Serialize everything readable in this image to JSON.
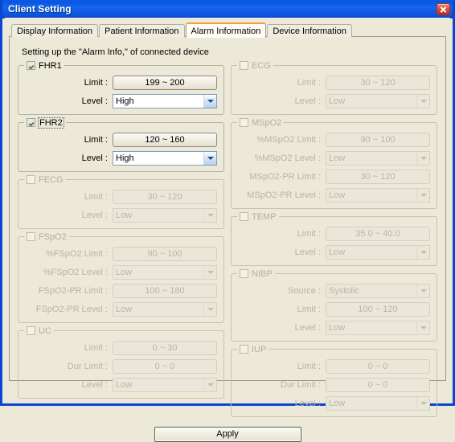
{
  "window": {
    "title": "Client Setting",
    "close_icon": "close-icon"
  },
  "tabs": [
    {
      "label": "Display Information",
      "active": false
    },
    {
      "label": "Patient Information",
      "active": false
    },
    {
      "label": "Alarm Information",
      "active": true
    },
    {
      "label": "Device Information",
      "active": false
    }
  ],
  "intro": "Setting up the \"Alarm Info,\" of connected device",
  "labels": {
    "limit": "Limit :",
    "level": "Level :",
    "dur_limit": "Dur Limit :",
    "source": "Source :"
  },
  "left_groups": [
    {
      "name": "FHR1",
      "enabled": true,
      "checked": true,
      "focused": false,
      "rows": [
        {
          "type": "limit",
          "label": "Limit :",
          "value": "199 ~ 200"
        },
        {
          "type": "combo",
          "label": "Level :",
          "value": "High"
        }
      ]
    },
    {
      "name": "FHR2",
      "enabled": true,
      "checked": true,
      "focused": true,
      "rows": [
        {
          "type": "limit",
          "label": "Limit :",
          "value": "120 ~ 160"
        },
        {
          "type": "combo",
          "label": "Level :",
          "value": "High"
        }
      ]
    },
    {
      "name": "FECG",
      "enabled": false,
      "checked": false,
      "focused": false,
      "rows": [
        {
          "type": "limit",
          "label": "Limit :",
          "value": "30 ~ 120"
        },
        {
          "type": "combo",
          "label": "Level :",
          "value": "Low"
        }
      ]
    },
    {
      "name": "FSpO2",
      "enabled": false,
      "checked": false,
      "focused": false,
      "rows": [
        {
          "type": "limit",
          "label": "%FSpO2 Limit :",
          "value": "90 ~ 100"
        },
        {
          "type": "combo",
          "label": "%FSpO2 Level :",
          "value": "Low"
        },
        {
          "type": "limit",
          "label": "FSpO2-PR Limit :",
          "value": "100 ~ 180"
        },
        {
          "type": "combo",
          "label": "FSpO2-PR Level :",
          "value": "Low"
        }
      ]
    },
    {
      "name": "UC",
      "enabled": false,
      "checked": false,
      "focused": false,
      "rows": [
        {
          "type": "limit",
          "label": "Limit :",
          "value": "0 ~ 30"
        },
        {
          "type": "limit",
          "label": "Dur Limit :",
          "value": "0 ~ 0"
        },
        {
          "type": "combo",
          "label": "Level :",
          "value": "Low"
        }
      ]
    }
  ],
  "right_groups": [
    {
      "name": "ECG",
      "enabled": false,
      "checked": false,
      "focused": false,
      "rows": [
        {
          "type": "limit",
          "label": "Limit :",
          "value": "30 ~ 120"
        },
        {
          "type": "combo",
          "label": "Level :",
          "value": "Low"
        }
      ]
    },
    {
      "name": "MSpO2",
      "enabled": false,
      "checked": false,
      "focused": false,
      "rows": [
        {
          "type": "limit",
          "label": "%MSpO2 Limit :",
          "value": "90 ~ 100"
        },
        {
          "type": "combo",
          "label": "%MSpO2 Level :",
          "value": "Low"
        },
        {
          "type": "limit",
          "label": "MSpO2-PR Limit :",
          "value": "30 ~ 120"
        },
        {
          "type": "combo",
          "label": "MSpO2-PR Level :",
          "value": "Low"
        }
      ]
    },
    {
      "name": "TEMP",
      "enabled": false,
      "checked": false,
      "focused": false,
      "rows": [
        {
          "type": "limit",
          "label": "Limit :",
          "value": "35.0 ~ 40.0"
        },
        {
          "type": "combo",
          "label": "Level :",
          "value": "Low"
        }
      ]
    },
    {
      "name": "NIBP",
      "enabled": false,
      "checked": false,
      "focused": false,
      "rows": [
        {
          "type": "combo",
          "label": "Source :",
          "value": "Systolic"
        },
        {
          "type": "limit",
          "label": "Limit :",
          "value": "100 ~ 120"
        },
        {
          "type": "combo",
          "label": "Level :",
          "value": "Low"
        }
      ]
    },
    {
      "name": "IUP",
      "enabled": false,
      "checked": false,
      "focused": false,
      "rows": [
        {
          "type": "limit",
          "label": "Limit :",
          "value": "0 ~ 0"
        },
        {
          "type": "limit",
          "label": "Dur Limit :",
          "value": "0 ~ 0"
        },
        {
          "type": "combo",
          "label": "Level :",
          "value": "Low"
        }
      ]
    }
  ],
  "apply": {
    "label": "Apply"
  },
  "colors": {
    "titlebar": "#0d52dd",
    "window_border": "#0a46d2",
    "background": "#ece9d8",
    "active_tab_accent": "#e8a33d",
    "close_button": "#c32a18",
    "combo_arrow": "#1c4e8f"
  }
}
